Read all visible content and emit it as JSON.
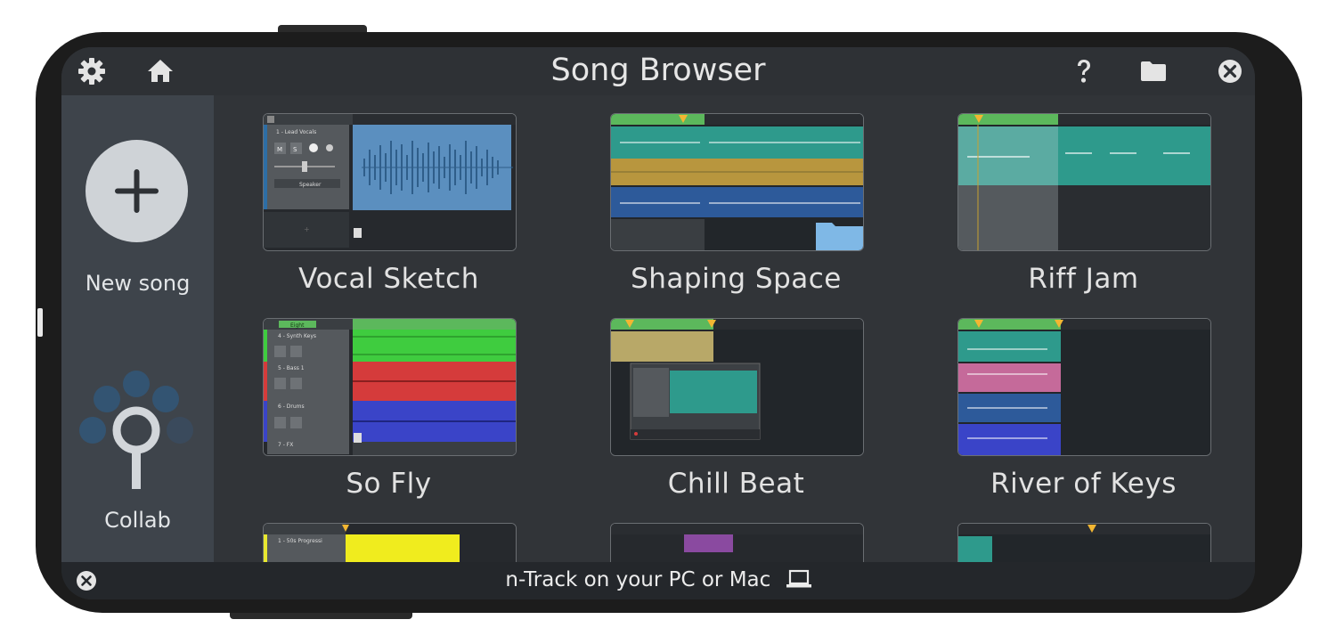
{
  "header": {
    "title": "Song Browser",
    "settings_icon": "gear-icon",
    "home_icon": "home-icon",
    "help_icon": "question-icon",
    "folder_icon": "folder-icon",
    "close_icon": "close-circle-icon"
  },
  "sidebar": {
    "new_song_label": "New song",
    "collab_label": "Collab"
  },
  "songs": [
    {
      "title": "Vocal Sketch"
    },
    {
      "title": "Shaping Space"
    },
    {
      "title": "Riff Jam"
    },
    {
      "title": "So Fly"
    },
    {
      "title": "Chill Beat"
    },
    {
      "title": "River of Keys"
    }
  ],
  "thumbs": {
    "vocal_track": "1 - Lead Vocals",
    "vocal_output": "Speaker",
    "synth_track": "4 - Synth Keys",
    "bass_track": "5 - Bass 1",
    "drums_track": "6 - Drums",
    "fx_track": "7 - FX",
    "sofly_badge": "Eight",
    "prog_track": "1 - 50s Progressi",
    "mute": "M",
    "solo": "S"
  },
  "footer": {
    "text": "n-Track on your PC or Mac",
    "close_icon": "close-circle-icon",
    "laptop_icon": "laptop-icon"
  },
  "colors": {
    "background": "#313438",
    "sidebar": "#3e444b",
    "accent_orange": "#f2b632",
    "track_green": "#3fcc3f",
    "track_red": "#d53b3b",
    "track_blue": "#3a44c8",
    "track_teal": "#2e9a8c"
  }
}
